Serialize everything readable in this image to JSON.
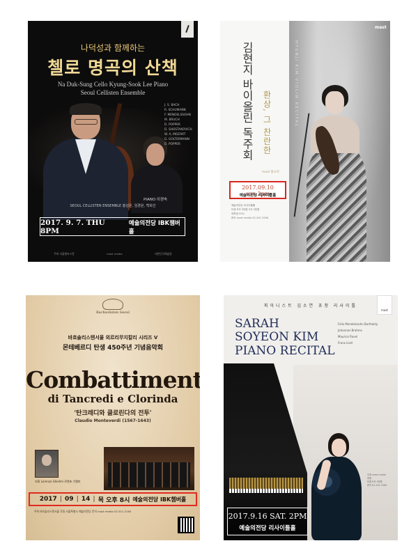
{
  "poster1": {
    "subtitle": "나덕성과 함께하는",
    "title": "첼로 명곡의 산책",
    "en_line1": "Na Duk-Sung  Cello  Kyung-Sook Lee  Piano",
    "en_line2": "Seoul Cellisten Ensemble",
    "composers": [
      "J. S. BACH",
      "R. SCHUMANN",
      "F. MENDELSSOHN",
      "M. BRUCH",
      "D. POPPER",
      "D. SHOSTAKOVICH",
      "W. A. MOZART",
      "G. GOLTERMANN",
      "D. POPPER"
    ],
    "piano_label": "PIANO 이경숙",
    "ensemble": "SEOUL CELLISTEN ENSEMBLE 홍성은, 임경원, 백희선",
    "date": "2017. 9. 7. THU 8PM",
    "venue": "예술의전당 IBK챔버홀",
    "sponsors": [
      "주최 서울첼리스텐",
      "mast media",
      "대한민국예술원"
    ]
  },
  "poster2": {
    "name_vertical": "김현지 바이올린 독주회",
    "phrase_vertical": "환상, 그 찬란한",
    "en_vertical": "HYUNJI KIM VIOLIN RECITAL",
    "logo": "mast",
    "mast_small": "mast 총소유",
    "date": "2017.09.10 sun.2pm",
    "venue": "예술의전당 리사이틀홀",
    "info": [
      "예술의전당 리사이틀홀",
      "티켓 R석 5만원 S석 3만원",
      "대학생 50%",
      "문의 mast media 02-541-3184"
    ]
  },
  "poster3": {
    "org": "Bachsolisten Seoul",
    "series": "바흐솔리스텐서울 외르리무지칼리 시리즈 V",
    "anniversary": "몬테베르디 탄생 450주년 기념음악회",
    "title": "Combattimento",
    "subtitle": "di Tancredi e Clorinda",
    "korean_title": "'탄크레디와 클로린다의 전투'",
    "composer": "Claudio Monteverdi (1567-1643)",
    "conductor": "지휘 Lorenzo Ghielmi 로렌초 기엘미",
    "date_year": "2017",
    "date_month": "09",
    "date_day": "14",
    "date_rest": "목 오후 8시",
    "venue": "예술의전당 IBK챔버홀",
    "fine_print": "주최 바흐솔리스텐서울  후원 서울특별시 예술의전당  문의 mast media 02-541-3184"
  },
  "poster4": {
    "top": "피아니스트 김소연 초청 리사이틀",
    "logo": "mast",
    "title_1": "SARAH",
    "title_2": "SOYEON KIM",
    "title_3": "PIANO RECITAL",
    "program": [
      "Felix Mendelssohn Bartholdy",
      "Johannes Brahms",
      "Maurice Ravel",
      "Franz Liszt"
    ],
    "sidebar": [
      "주최 mast media",
      "후원",
      "티켓 R석 5만원",
      "문의 02-541-3184"
    ],
    "date": "2017.9.16 SAT. 2PM",
    "venue": "예술의전당 리사이틀홀"
  }
}
